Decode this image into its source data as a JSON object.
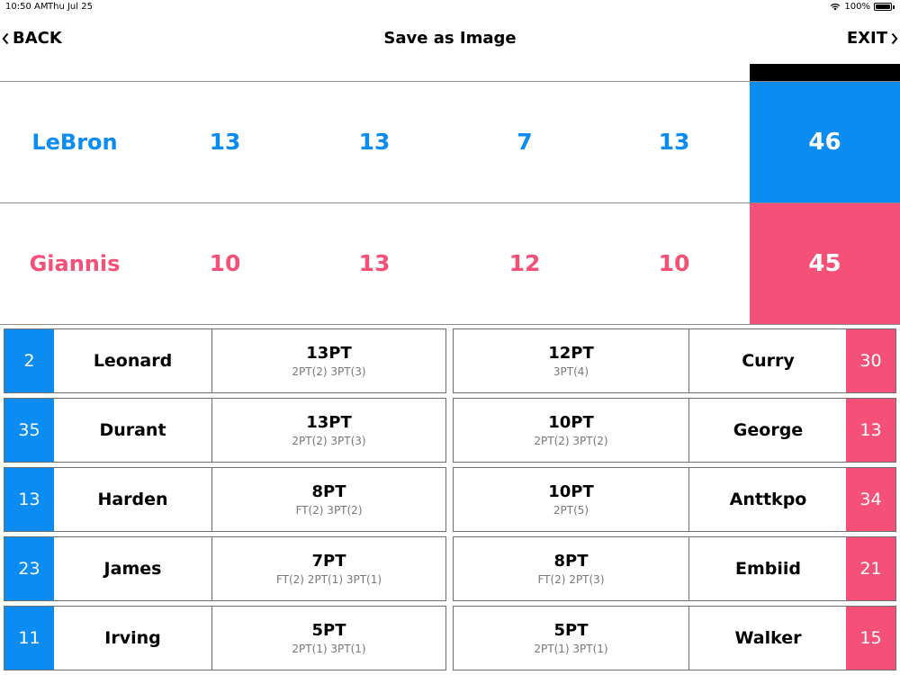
{
  "status": {
    "time": "10:50 AM",
    "date": "Thu Jul 25",
    "battery": "100%"
  },
  "nav": {
    "back_label": "BACK",
    "title": "Save as Image",
    "exit_label": "EXIT"
  },
  "colors": {
    "blue": "#0a8cf2",
    "pink": "#f45078"
  },
  "scoreboard": [
    {
      "name": "LeBron",
      "quarters": [
        "13",
        "13",
        "7",
        "13"
      ],
      "total": "46",
      "color": "#0a8cf2"
    },
    {
      "name": "Giannis",
      "quarters": [
        "10",
        "13",
        "12",
        "10"
      ],
      "total": "45",
      "color": "#f45078"
    }
  ],
  "left_team": [
    {
      "number": "2",
      "name": "Leonard",
      "points": "13PT",
      "detail": "2PT(2)  3PT(3)"
    },
    {
      "number": "35",
      "name": "Durant",
      "points": "13PT",
      "detail": "2PT(2)  3PT(3)"
    },
    {
      "number": "13",
      "name": "Harden",
      "points": "8PT",
      "detail": "FT(2)  3PT(2)"
    },
    {
      "number": "23",
      "name": "James",
      "points": "7PT",
      "detail": "FT(2)  2PT(1)  3PT(1)"
    },
    {
      "number": "11",
      "name": "Irving",
      "points": "5PT",
      "detail": "2PT(1)  3PT(1)"
    }
  ],
  "right_team": [
    {
      "number": "30",
      "name": "Curry",
      "points": "12PT",
      "detail": "3PT(4)"
    },
    {
      "number": "13",
      "name": "George",
      "points": "10PT",
      "detail": "2PT(2)  3PT(2)"
    },
    {
      "number": "34",
      "name": "Anttkpo",
      "points": "10PT",
      "detail": "2PT(5)"
    },
    {
      "number": "21",
      "name": "Embiid",
      "points": "8PT",
      "detail": "FT(2)  2PT(3)"
    },
    {
      "number": "15",
      "name": "Walker",
      "points": "5PT",
      "detail": "2PT(1)  3PT(1)"
    }
  ]
}
